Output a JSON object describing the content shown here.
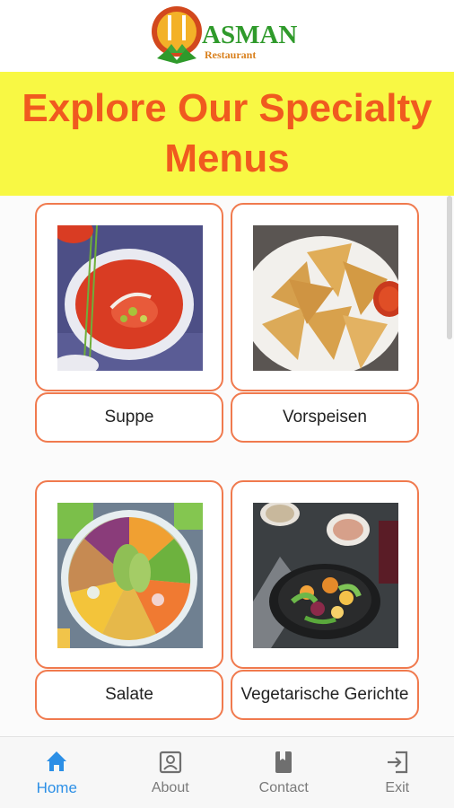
{
  "brand": {
    "name": "ASMAN",
    "subtitle": "Restaurant"
  },
  "banner": {
    "title": "Explore Our Specialty Menus"
  },
  "menu_items": [
    {
      "label": "Suppe",
      "image": "tomato-soup-bowl"
    },
    {
      "label": "Vorspeisen",
      "image": "samosa-plate"
    },
    {
      "label": "Salate",
      "image": "salad-bowl"
    },
    {
      "label": "Vegetarische Gerichte",
      "image": "vegetable-skillet"
    }
  ],
  "nav": {
    "items": [
      {
        "label": "Home",
        "icon": "home-icon",
        "active": true
      },
      {
        "label": "About",
        "icon": "profile-icon",
        "active": false
      },
      {
        "label": "Contact",
        "icon": "book-icon",
        "active": false
      },
      {
        "label": "Exit",
        "icon": "exit-icon",
        "active": false
      }
    ]
  },
  "colors": {
    "accent": "#f05a1f",
    "banner_bg": "#f8f844",
    "card_border": "#f07a4e",
    "nav_active": "#2c8fe6",
    "brand_green": "#2f9a2b"
  }
}
